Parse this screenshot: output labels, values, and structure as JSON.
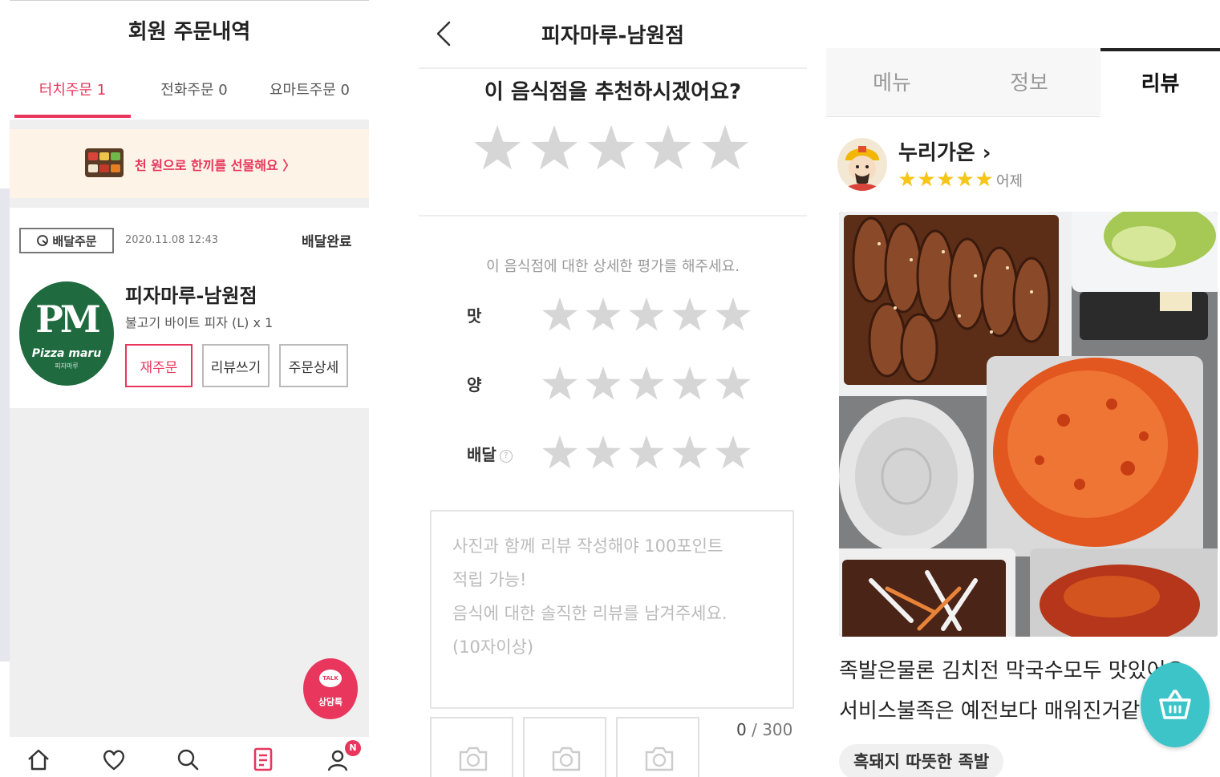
{
  "order_history": {
    "title": "회원 주문내역",
    "tabs": [
      {
        "label": "터치주문 1",
        "active": true
      },
      {
        "label": "전화주문 0",
        "active": false
      },
      {
        "label": "요마트주문 0",
        "active": false
      }
    ],
    "banner_text": "천 원으로 한끼를 선물해요  〉",
    "order": {
      "type_label": "배달주문",
      "date": "2020.11.08 12:43",
      "status": "배달완료",
      "logo_text": "PM",
      "logo_brand": "Pizza maru",
      "logo_sub": "피자마루",
      "store_name": "피자마루-남원점",
      "item": "불고기 바이트 피자  (L)   x 1",
      "buttons": {
        "reorder": "재주문",
        "write_review": "리뷰쓰기",
        "order_detail": "주문상세"
      }
    },
    "talk_bubble": "TALK",
    "talk_label": "상담톡",
    "nav_badge": "N",
    "colors": {
      "accent": "#e8365d",
      "logo_green": "#1f6a3f"
    }
  },
  "review_write": {
    "title": "피자마루-남원점",
    "question": "이 음식점을 추천하시겠어요?",
    "overall_rating": 0,
    "detail_prompt": "이 음식점에 대한 상세한 평가를 해주세요.",
    "criteria": [
      {
        "label": "맛",
        "rating": 0
      },
      {
        "label": "양",
        "rating": 0
      },
      {
        "label": "배달",
        "rating": 0
      }
    ],
    "help_icon": "?",
    "placeholder_lines": [
      "사진과 함께 리뷰 작성해야 100포인트",
      "적립 가능!",
      "음식에 대한 솔직한 리뷰를 남겨주세요.",
      "(10자이상)"
    ],
    "char_count": "0",
    "char_limit": "/ 300"
  },
  "store_review": {
    "tabs": [
      {
        "label": "메뉴",
        "active": false
      },
      {
        "label": "정보",
        "active": false
      },
      {
        "label": "리뷰",
        "active": true
      }
    ],
    "reviewer": "누리가온 ›",
    "rating": 5,
    "time": "어제",
    "text_lines": [
      "족발은물론 김치전 막국수모두 맛있어요",
      "서비스불족은 예전보다 매워진거같"
    ],
    "tag": "흑돼지 따뜻한 족발",
    "colors": {
      "star": "#f5c518",
      "fab": "#3cc4c8"
    }
  }
}
